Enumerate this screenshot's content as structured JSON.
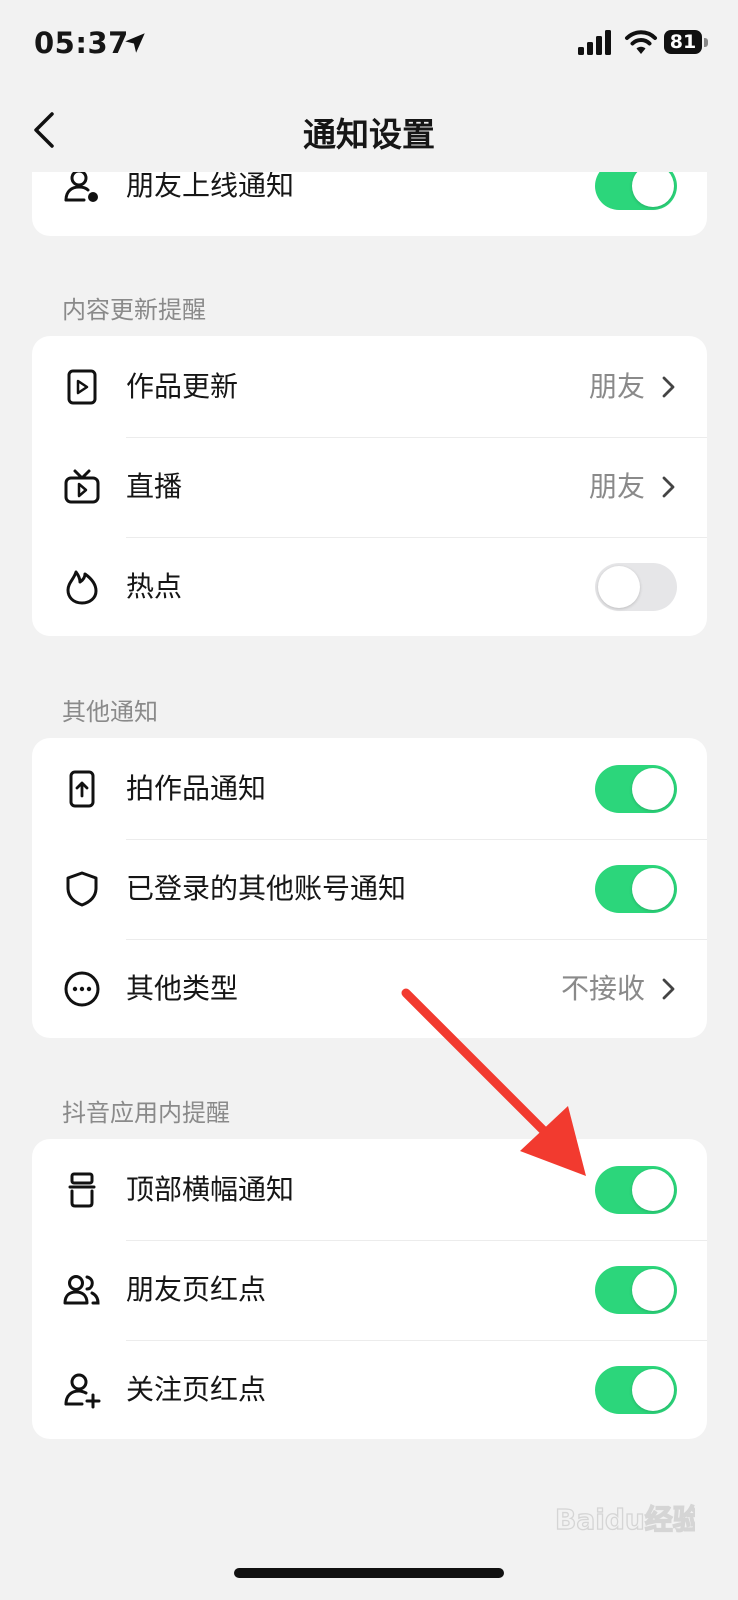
{
  "status_bar": {
    "time": "05:37",
    "battery": "81"
  },
  "header": {
    "title": "通知设置"
  },
  "top_card": {
    "items": [
      {
        "label": "朋友上线通知",
        "toggle": "on",
        "icon": "user-dot-icon"
      }
    ]
  },
  "content_updates": {
    "header": "内容更新提醒",
    "items": [
      {
        "label": "作品更新",
        "value": "朋友",
        "icon": "video-icon"
      },
      {
        "label": "直播",
        "value": "朋友",
        "icon": "tv-play-icon"
      },
      {
        "label": "热点",
        "toggle": "off",
        "icon": "flame-icon"
      }
    ]
  },
  "other": {
    "header": "其他通知",
    "items": [
      {
        "label": "拍作品通知",
        "toggle": "on",
        "icon": "phone-upload-icon"
      },
      {
        "label": "已登录的其他账号通知",
        "toggle": "on",
        "icon": "shield-icon"
      },
      {
        "label": "其他类型",
        "value": "不接收",
        "icon": "more-circle-icon"
      }
    ]
  },
  "in_app": {
    "header": "抖音应用内提醒",
    "items": [
      {
        "label": "顶部横幅通知",
        "toggle": "on",
        "icon": "banner-icon"
      },
      {
        "label": "朋友页红点",
        "toggle": "on",
        "icon": "friends-icon"
      },
      {
        "label": "关注页红点",
        "toggle": "on",
        "icon": "follow-add-icon"
      }
    ]
  },
  "watermark": {
    "text": "Baidu经验"
  },
  "colors": {
    "toggle_on": "#2cd67b",
    "toggle_off": "#e6e6e8",
    "annotation_arrow": "#f23a2f"
  }
}
